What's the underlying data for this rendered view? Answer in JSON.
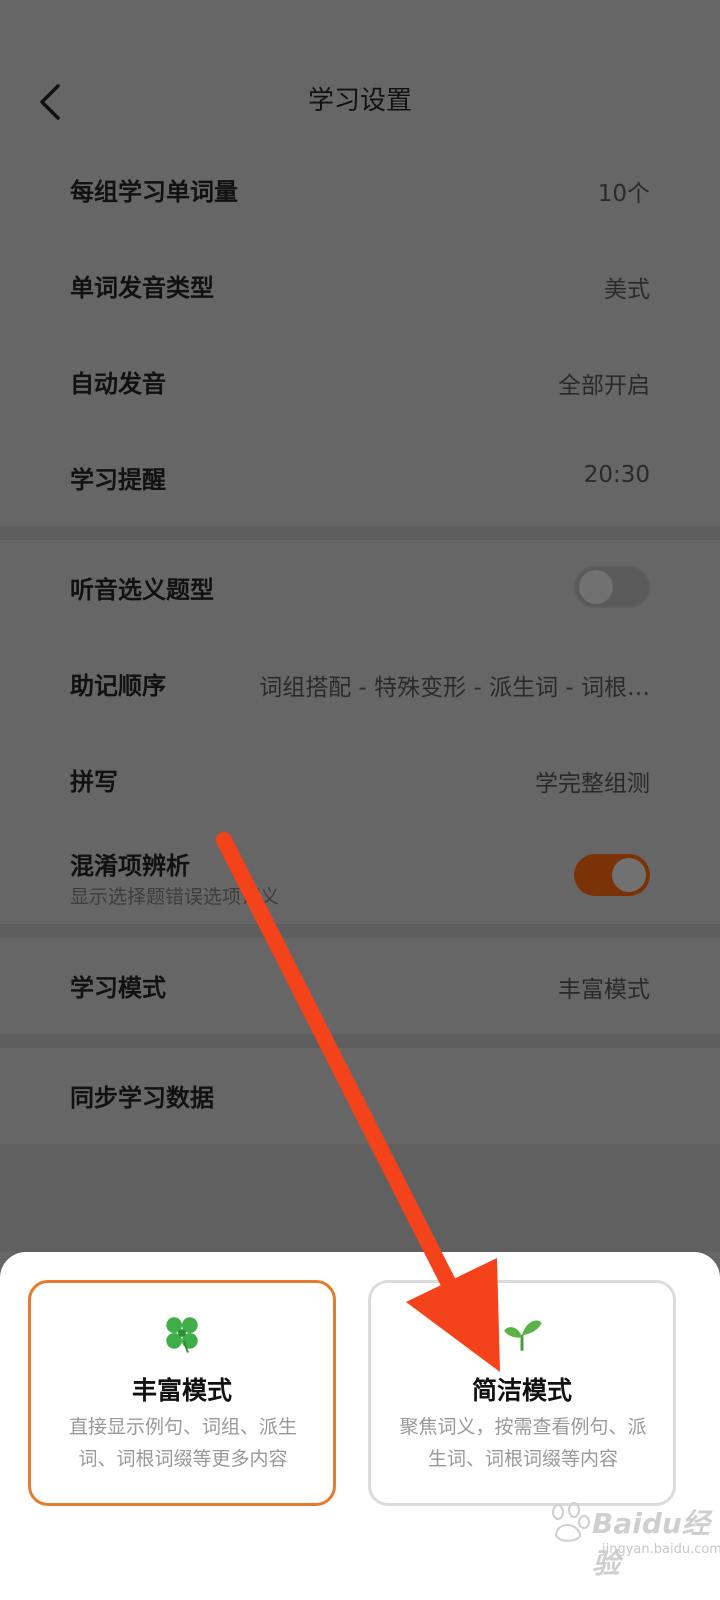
{
  "header": {
    "title": "学习设置",
    "back_icon": "chevron-left-icon"
  },
  "settings_group1": [
    {
      "label": "每组学习单词量",
      "value": "10个"
    },
    {
      "label": "单词发音类型",
      "value": "美式"
    },
    {
      "label": "自动发音",
      "value": "全部开启"
    },
    {
      "label": "学习提醒",
      "value": "20:30"
    }
  ],
  "settings_group2": {
    "listen_choice": {
      "label": "听音选义题型",
      "toggle": "off"
    },
    "mnemonic_order": {
      "label": "助记顺序",
      "value": "词组搭配 - 特殊变形 - 派生词 - 词根…"
    },
    "spelling": {
      "label": "拼写",
      "value": "学完整组测"
    },
    "confusion": {
      "label": "混淆项辨析",
      "sub": "显示选择题错误选项词义",
      "toggle": "on"
    }
  },
  "study_mode": {
    "label": "学习模式",
    "value": "丰富模式"
  },
  "sync": {
    "label": "同步学习数据"
  },
  "sheet": {
    "rich": {
      "icon": "clover-icon",
      "title": "丰富模式",
      "desc": "直接显示例句、词组、派生词、词根词缀等更多内容",
      "selected": true
    },
    "simple": {
      "icon": "sprout-icon",
      "title": "简洁模式",
      "desc": "聚焦词义，按需查看例句、派生词、词根词缀等内容",
      "selected": false
    }
  },
  "colors": {
    "accent": "#e87a2c",
    "toggle_on": "#7a3206",
    "arrow": "#f4421a",
    "overlay": "#666666"
  },
  "watermark": {
    "main": "Baidu经验",
    "sub": "jingyan.baidu.com"
  }
}
